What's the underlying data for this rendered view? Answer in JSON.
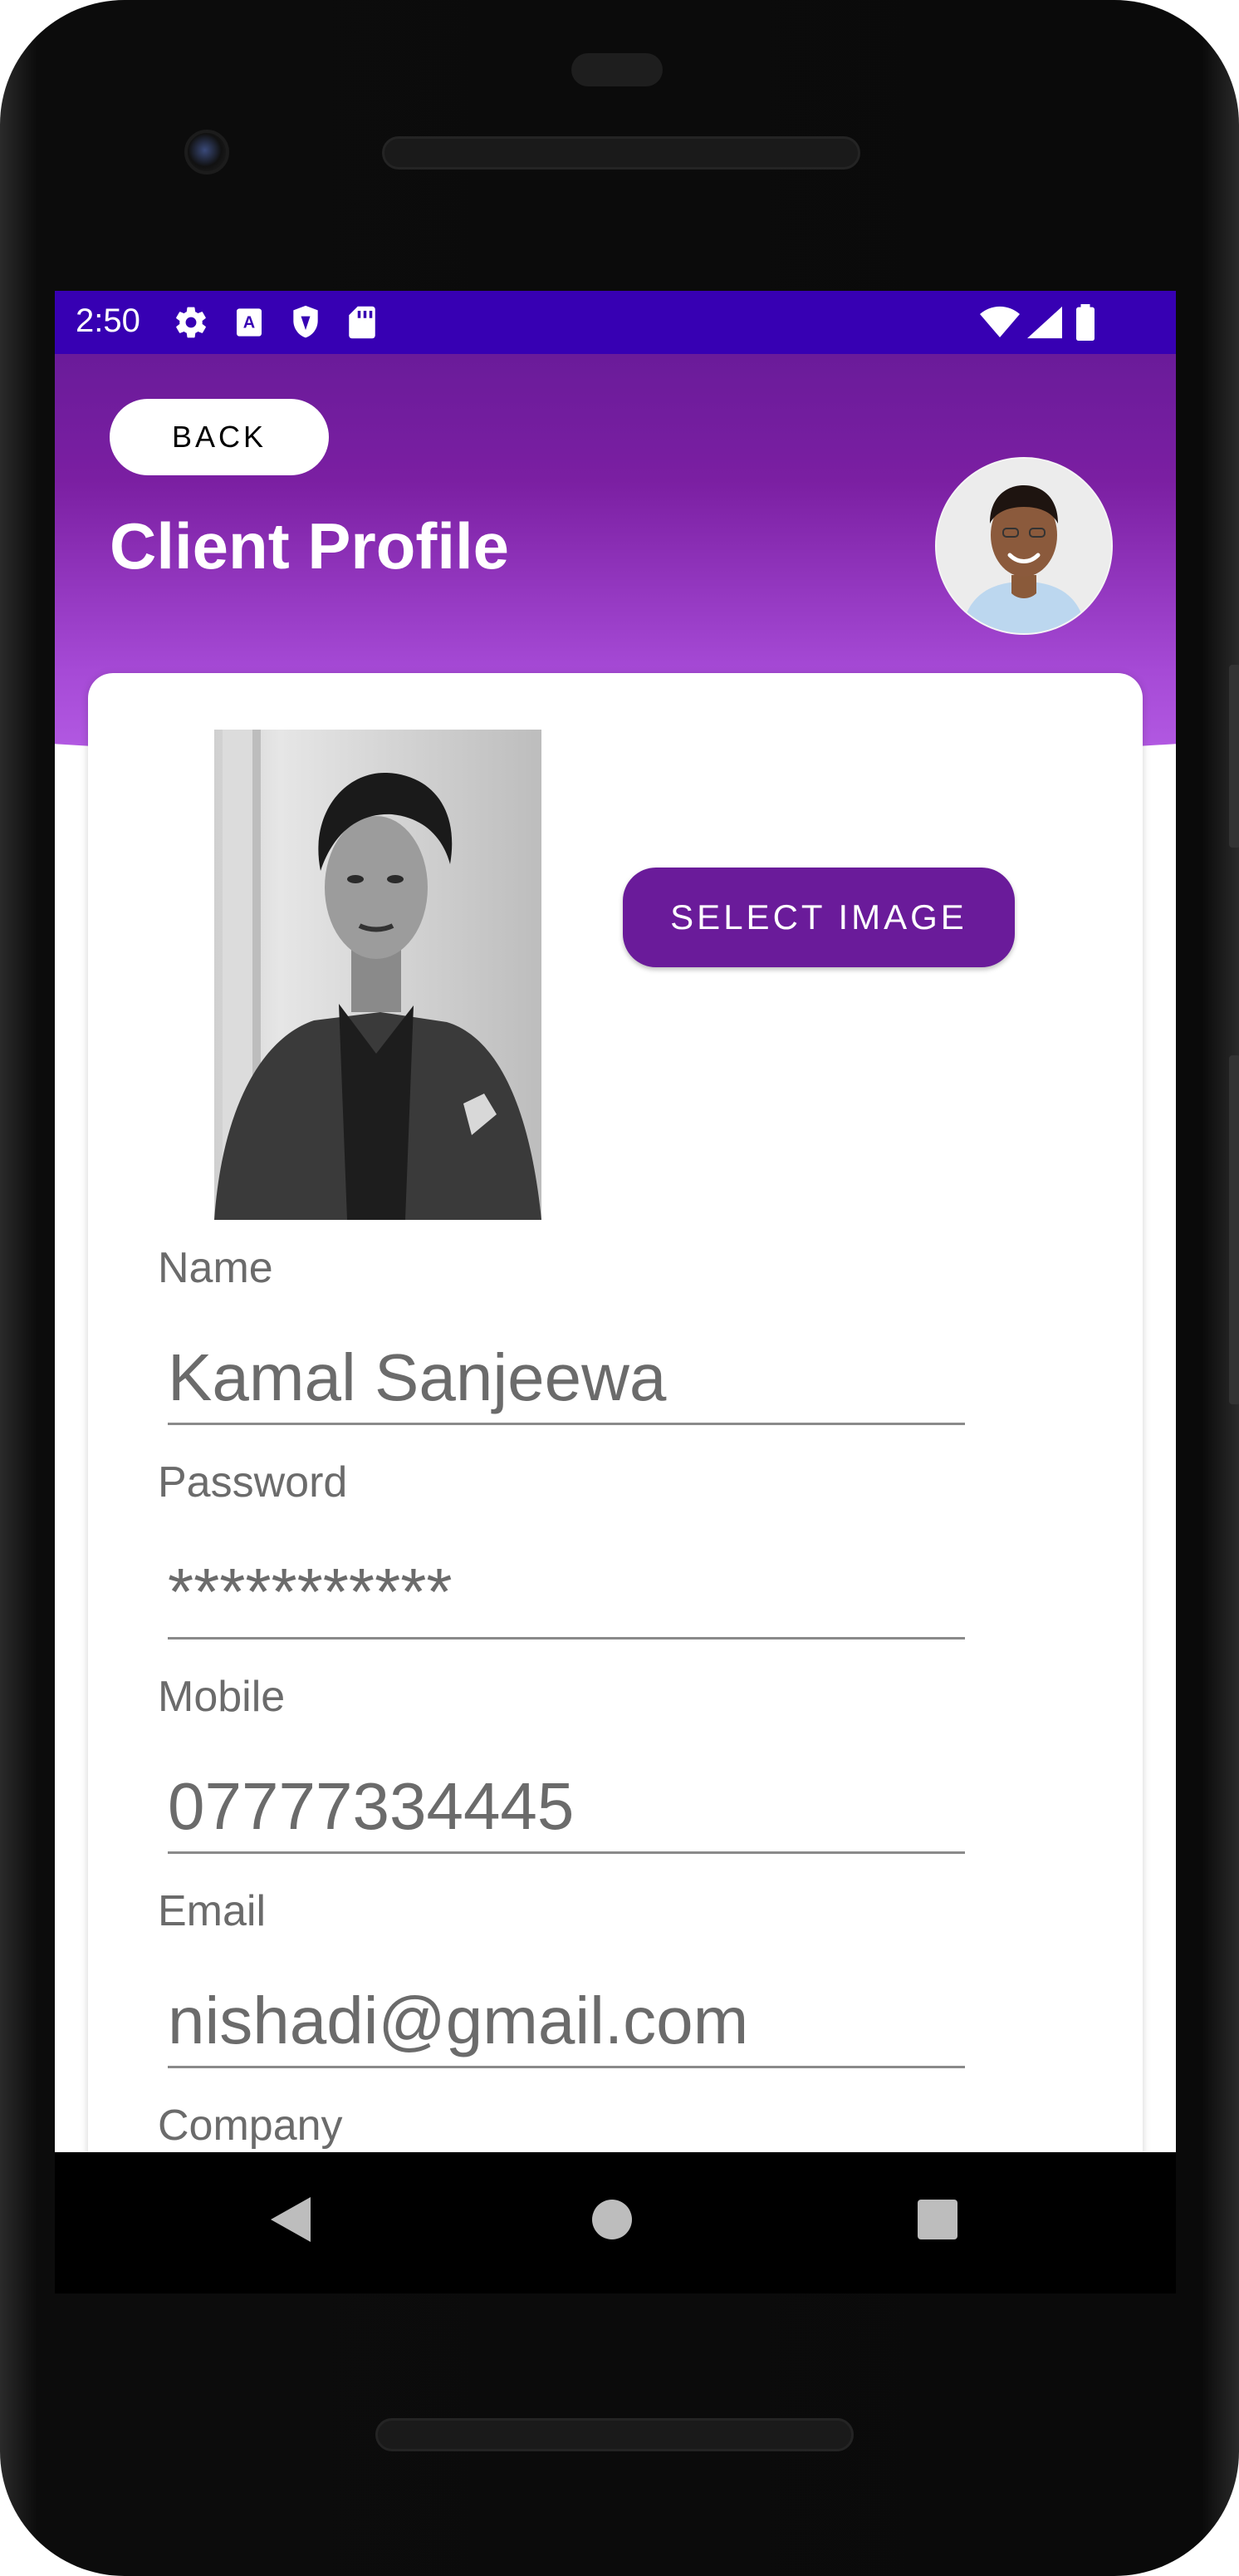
{
  "status_bar": {
    "time": "2:50",
    "left_icons": [
      "gear-icon",
      "a-icon",
      "shield-icon",
      "sd-card-icon"
    ],
    "right_icons": [
      "wifi-icon",
      "signal-icon",
      "battery-icon"
    ]
  },
  "header": {
    "back_label": "BACK",
    "title": "Client Profile"
  },
  "profile": {
    "select_image_label": "SELECT IMAGE"
  },
  "form": {
    "name_label": "Name",
    "name_value": "Kamal Sanjeewa",
    "password_label": "Password",
    "password_value": "***********",
    "mobile_label": "Mobile",
    "mobile_value": "07777334445",
    "email_label": "Email",
    "email_value": "nishadi@gmail.com",
    "company_label": "Company"
  },
  "nav_bar": {
    "buttons": [
      "back-triangle-icon",
      "home-circle-icon",
      "recents-square-icon"
    ]
  },
  "colors": {
    "status_bar": "#3700b3",
    "header_top": "#6a1b9a",
    "header_bottom": "#b65ee6",
    "accent": "#6a1b9a"
  }
}
